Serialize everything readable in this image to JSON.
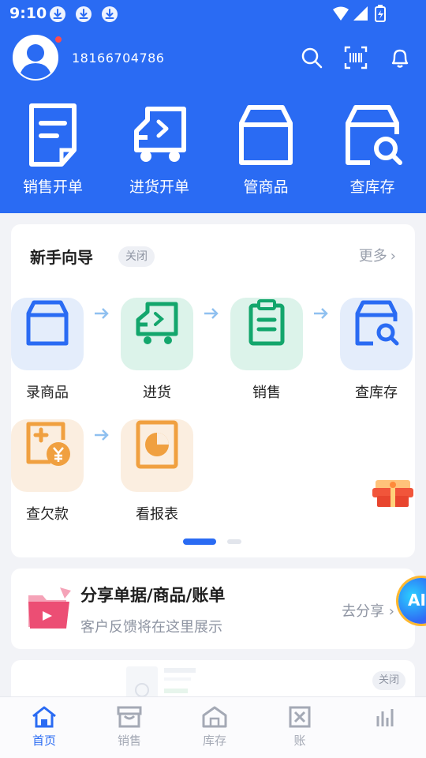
{
  "status_bar": {
    "time": "9:10"
  },
  "header": {
    "phone": "18166704786"
  },
  "quick_actions": [
    {
      "label": "销售开单",
      "icon": "sales-order-icon"
    },
    {
      "label": "进货开单",
      "icon": "purchase-order-icon"
    },
    {
      "label": "管商品",
      "icon": "product-box-icon"
    },
    {
      "label": "查库存",
      "icon": "inventory-search-icon"
    }
  ],
  "guide": {
    "title": "新手向导",
    "close_label": "关闭",
    "more_label": "更多",
    "steps": [
      {
        "label": "录商品",
        "icon": "product-box-icon"
      },
      {
        "label": "进货",
        "icon": "truck-icon"
      },
      {
        "label": "销售",
        "icon": "clipboard-icon"
      },
      {
        "label": "查库存",
        "icon": "inventory-search-icon"
      },
      {
        "label": "查欠款",
        "icon": "debt-yen-icon"
      },
      {
        "label": "看报表",
        "icon": "report-chart-icon"
      }
    ]
  },
  "share": {
    "title": "分享单据/商品/账单",
    "subtitle": "客户反馈将在这里展示",
    "action_label": "去分享"
  },
  "ai_button": {
    "label": "AI"
  },
  "ad": {
    "close_label": "关闭"
  },
  "bottom_nav": [
    {
      "label": "首页",
      "icon": "home-icon",
      "active": true
    },
    {
      "label": "销售",
      "icon": "store-icon",
      "active": false
    },
    {
      "label": "库存",
      "icon": "warehouse-icon",
      "active": false
    },
    {
      "label": "账",
      "icon": "ledger-icon",
      "active": false
    },
    {
      "label": "",
      "icon": "report-bars-icon",
      "active": false
    }
  ],
  "colors": {
    "primary": "#2a6bf3",
    "background": "#f2f3f7"
  }
}
